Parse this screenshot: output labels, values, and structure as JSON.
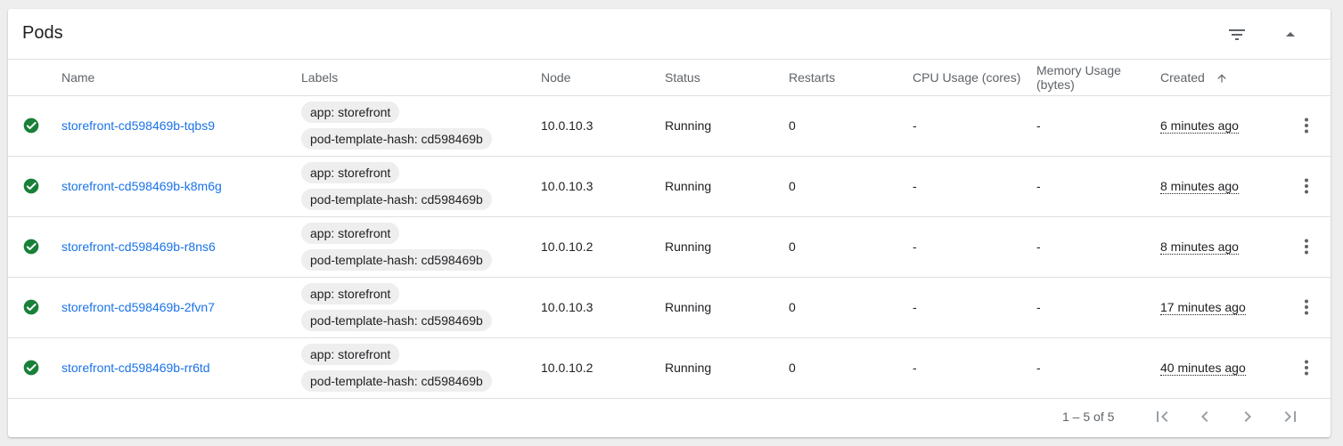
{
  "card": {
    "title": "Pods"
  },
  "header_icons": [
    "filter-list-icon",
    "arrow-drop-up-icon"
  ],
  "table": {
    "columns": [
      {
        "key": "status",
        "label": ""
      },
      {
        "key": "name",
        "label": "Name"
      },
      {
        "key": "labels",
        "label": "Labels"
      },
      {
        "key": "node",
        "label": "Node"
      },
      {
        "key": "status_text",
        "label": "Status"
      },
      {
        "key": "restarts",
        "label": "Restarts"
      },
      {
        "key": "cpu",
        "label": "CPU Usage (cores)"
      },
      {
        "key": "memory",
        "label": "Memory Usage (bytes)"
      },
      {
        "key": "created",
        "label": "Created"
      }
    ],
    "rows": [
      {
        "name": "storefront-cd598469b-tqbs9",
        "labels": [
          "app: storefront",
          "pod-template-hash: cd598469b"
        ],
        "node": "10.0.10.3",
        "status": "Running",
        "restarts": "0",
        "cpu": "-",
        "memory": "-",
        "created": "6 minutes ago"
      },
      {
        "name": "storefront-cd598469b-k8m6g",
        "labels": [
          "app: storefront",
          "pod-template-hash: cd598469b"
        ],
        "node": "10.0.10.3",
        "status": "Running",
        "restarts": "0",
        "cpu": "-",
        "memory": "-",
        "created": "8 minutes ago"
      },
      {
        "name": "storefront-cd598469b-r8ns6",
        "labels": [
          "app: storefront",
          "pod-template-hash: cd598469b"
        ],
        "node": "10.0.10.2",
        "status": "Running",
        "restarts": "0",
        "cpu": "-",
        "memory": "-",
        "created": "8 minutes ago"
      },
      {
        "name": "storefront-cd598469b-2fvn7",
        "labels": [
          "app: storefront",
          "pod-template-hash: cd598469b"
        ],
        "node": "10.0.10.3",
        "status": "Running",
        "restarts": "0",
        "cpu": "-",
        "memory": "-",
        "created": "17 minutes ago"
      },
      {
        "name": "storefront-cd598469b-rr6td",
        "labels": [
          "app: storefront",
          "pod-template-hash: cd598469b"
        ],
        "node": "10.0.10.2",
        "status": "Running",
        "restarts": "0",
        "cpu": "-",
        "memory": "-",
        "created": "40 minutes ago"
      }
    ]
  },
  "pagination": {
    "range_label": "1 – 5 of 5"
  },
  "colors": {
    "link": "#1a73e8",
    "success": "#188038",
    "chip_bg": "#eeeeee"
  }
}
